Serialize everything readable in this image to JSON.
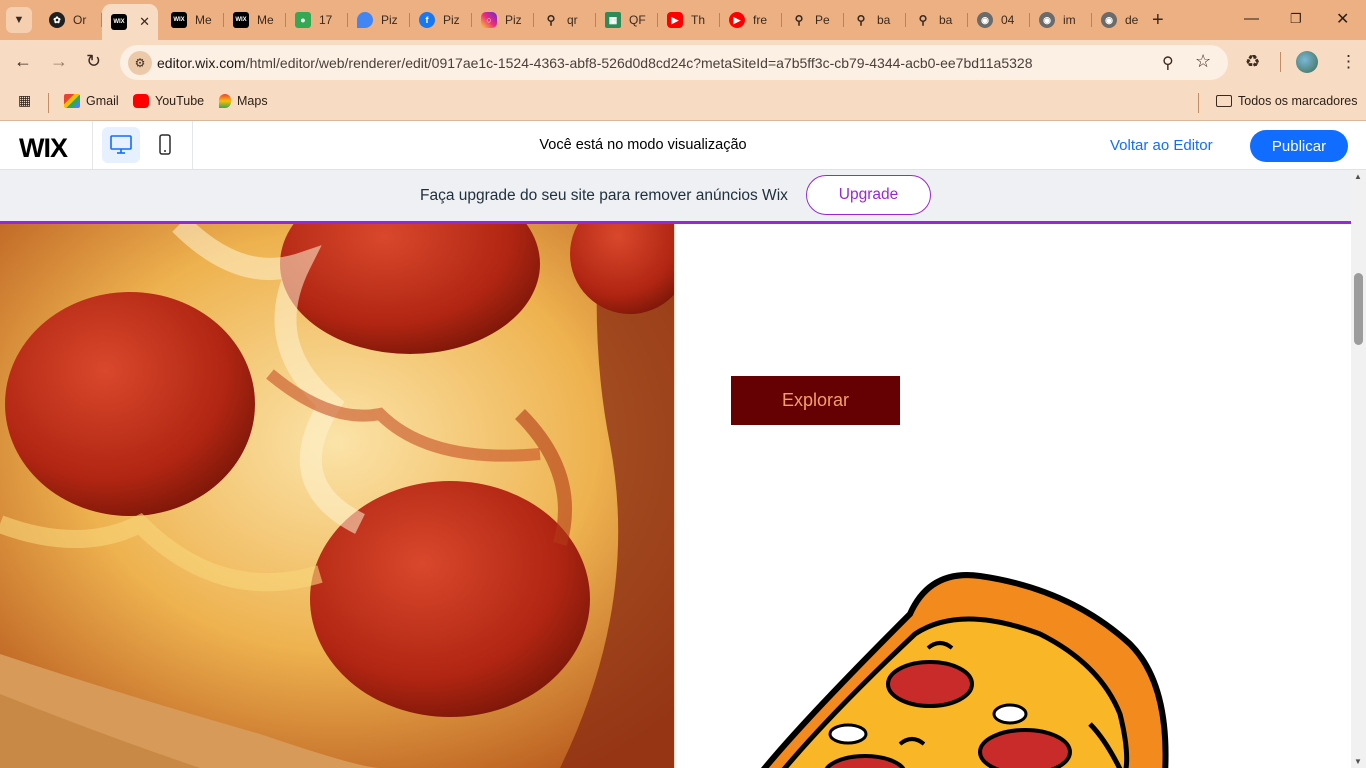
{
  "browser": {
    "tabs": [
      {
        "label": "Or",
        "icon": "openai-icon",
        "color": "#202020"
      },
      {
        "label": "",
        "icon": "wix-icon",
        "color": "#000000",
        "active": true
      },
      {
        "label": "Me",
        "icon": "wix-icon",
        "color": "#000000"
      },
      {
        "label": "Me",
        "icon": "wix-icon",
        "color": "#000000"
      },
      {
        "label": "17",
        "icon": "maps-pin-icon",
        "color": "#34a853"
      },
      {
        "label": "Piz",
        "icon": "maps-icon",
        "color": "#4285f4"
      },
      {
        "label": "Piz",
        "icon": "facebook-icon",
        "color": "#1877f2"
      },
      {
        "label": "Piz",
        "icon": "instagram-icon",
        "color": "#d62976"
      },
      {
        "label": "qr",
        "icon": "search-icon",
        "color": "#3b2a1e"
      },
      {
        "label": "QF",
        "icon": "qr-icon",
        "color": "#2e8b57"
      },
      {
        "label": "Th",
        "icon": "youtube-icon",
        "color": "#ff0000"
      },
      {
        "label": "fre",
        "icon": "youtube-icon",
        "color": "#ff0000"
      },
      {
        "label": "Pe",
        "icon": "search-icon",
        "color": "#3b2a1e"
      },
      {
        "label": "ba",
        "icon": "search-icon",
        "color": "#3b2a1e"
      },
      {
        "label": "ba",
        "icon": "search-icon",
        "color": "#3b2a1e"
      },
      {
        "label": "04",
        "icon": "globe-icon",
        "color": "#6b6b6b"
      },
      {
        "label": "im",
        "icon": "globe-icon",
        "color": "#6b6b6b"
      },
      {
        "label": "de",
        "icon": "globe-icon",
        "color": "#6b6b6b"
      }
    ],
    "url_host": "editor.wix.com",
    "url_path": "/html/editor/web/renderer/edit/0917ae1c-1524-4363-abf8-526d0d8cd24c?metaSiteId=a7b5ff3c-cb79-4344-acb0-ee7bd11a5328",
    "bookmarks": [
      {
        "label": "Gmail",
        "icon": "gmail-icon"
      },
      {
        "label": "YouTube",
        "icon": "youtube-icon"
      },
      {
        "label": "Maps",
        "icon": "maps-icon"
      }
    ],
    "all_bookmarks": "Todos os marcadores"
  },
  "wix": {
    "logo": "WIX",
    "preview_message": "Você está no modo visualização",
    "back_to_editor": "Voltar ao Editor",
    "publish": "Publicar",
    "accent_color": "#116dff"
  },
  "banner": {
    "text": "Faça upgrade do seu site para remover anúncios Wix",
    "button": "Upgrade",
    "color": "#9a27d5"
  },
  "site": {
    "explore_button": "Explorar",
    "explore_bg": "#650003",
    "explore_text_color": "#f2a06b"
  }
}
